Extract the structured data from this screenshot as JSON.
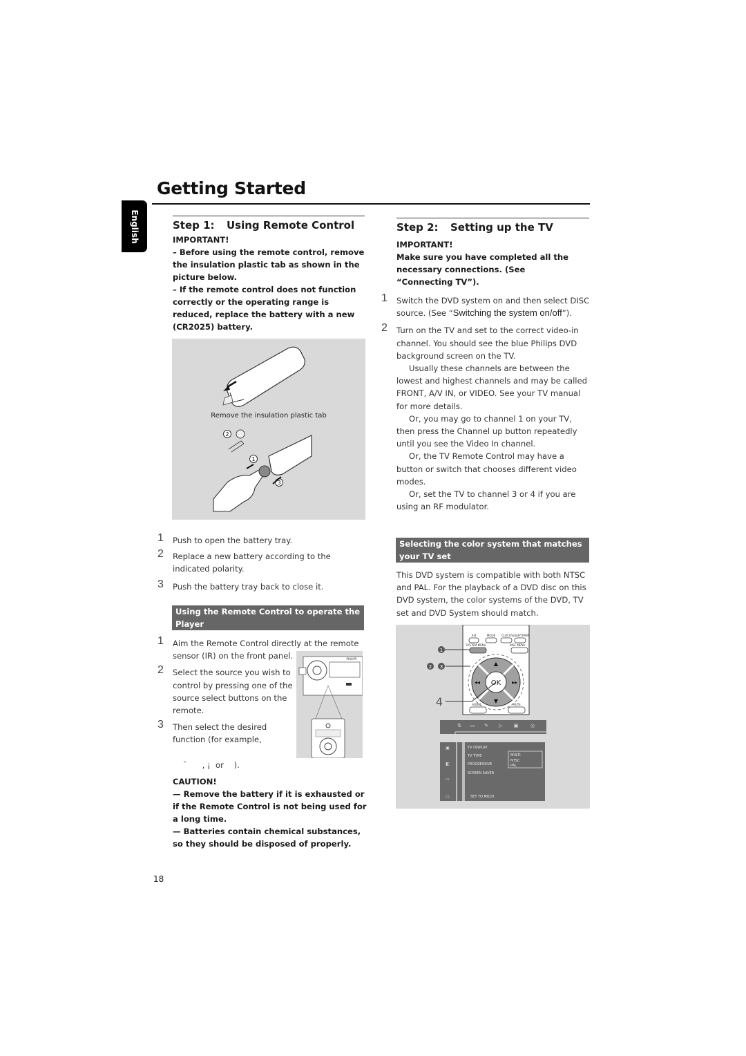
{
  "page": {
    "title": "Getting Started",
    "language_tab": "English",
    "page_number": "18"
  },
  "step1": {
    "heading_num": "Step 1:",
    "heading_text": "Using Remote Control",
    "important_label": "IMPORTANT!",
    "important_items": [
      "–  Before using the remote control, remove the insulation plastic tab as shown in the picture below.",
      "–  If the remote control does not function correctly or the operating range is reduced, replace the battery with a new (CR2025) battery."
    ],
    "figure": {
      "caption": "Remove the insulation plastic tab",
      "callouts": [
        "1",
        "2",
        "3"
      ]
    },
    "battery_steps": [
      {
        "n": "1",
        "text": "Push to open the battery tray."
      },
      {
        "n": "2",
        "text": "Replace a new battery according to the indicated polarity."
      },
      {
        "n": "3",
        "text": "Push the battery tray back to close it."
      }
    ],
    "banner": "Using the Remote Control to operate the Player",
    "operate_steps": [
      {
        "n": "1",
        "text": "Aim the Remote Control directly at the remote sensor (IR) on the front panel."
      },
      {
        "n": "2",
        "text": "Select the source you wish to control by pressing one of the source select buttons on the remote."
      },
      {
        "n": "3",
        "text": "Then select the desired function (for example,"
      },
      {
        "n": "",
        "text": "ˉ      , ¡  or    )."
      }
    ],
    "device_brand": "PHILIPS",
    "caution_label": "CAUTION!",
    "caution_items": [
      "— Remove the battery if it is exhausted or if the Remote Control is not being used for a long time.",
      "— Batteries contain chemical substances, so they should be disposed of properly."
    ]
  },
  "step2": {
    "heading_num": "Step 2:",
    "heading_text": "Setting up the TV",
    "important_label": "IMPORTANT!",
    "important_text": "Make sure you have completed all the necessary connections. (See “Connecting TV”).",
    "steps": [
      {
        "n": "1",
        "text_a": "Switch the DVD system on and then select DISC source. (See “",
        "text_link": "Switching the system on/off",
        "text_b": "”)."
      },
      {
        "n": "2",
        "text": "Turn on the TV and set to the correct video-in channel. You should see the blue Philips DVD background screen on the TV."
      }
    ],
    "paragraphs": [
      "Usually these channels are between the lowest and highest channels and may be called FRONT, A/V IN, or VIDEO. See your TV manual for more details.",
      "Or, you may go to channel 1 on your TV, then press the Channel up button repeatedly until you see the Video In channel.",
      "Or, the TV Remote Control may have a button or switch that chooses different video modes.",
      "Or, set the TV to channel 3 or 4 if you are using an RF modulator."
    ],
    "banner": "Selecting the color system that matches your TV set",
    "color_text": "This DVD system is compatible with both NTSC and PAL. For the playback of a DVD disc on this DVD system, the color systems of the DVD, TV set and DVD System should match.",
    "remote_figure": {
      "buttons_top": [
        "A-B",
        "MODE",
        "CLOCK",
        "SLEEP/TIMER"
      ],
      "system_menu": "SYSTEM MENU",
      "disc_menu": "DISC MENU",
      "ok": "OK",
      "audio": "AUDIO",
      "mute": "MUTE",
      "callouts": [
        "1",
        "2",
        "3",
        "4"
      ]
    },
    "osd_menu": {
      "items": [
        "TV DISPLAY",
        "TV TYPE",
        "PROGRESSIVE",
        "SCREEN SAVER"
      ],
      "footer": "SET TO MULTI",
      "options": [
        "MULTI",
        "NTSC",
        "PAL"
      ],
      "selected": "MULTI"
    }
  }
}
